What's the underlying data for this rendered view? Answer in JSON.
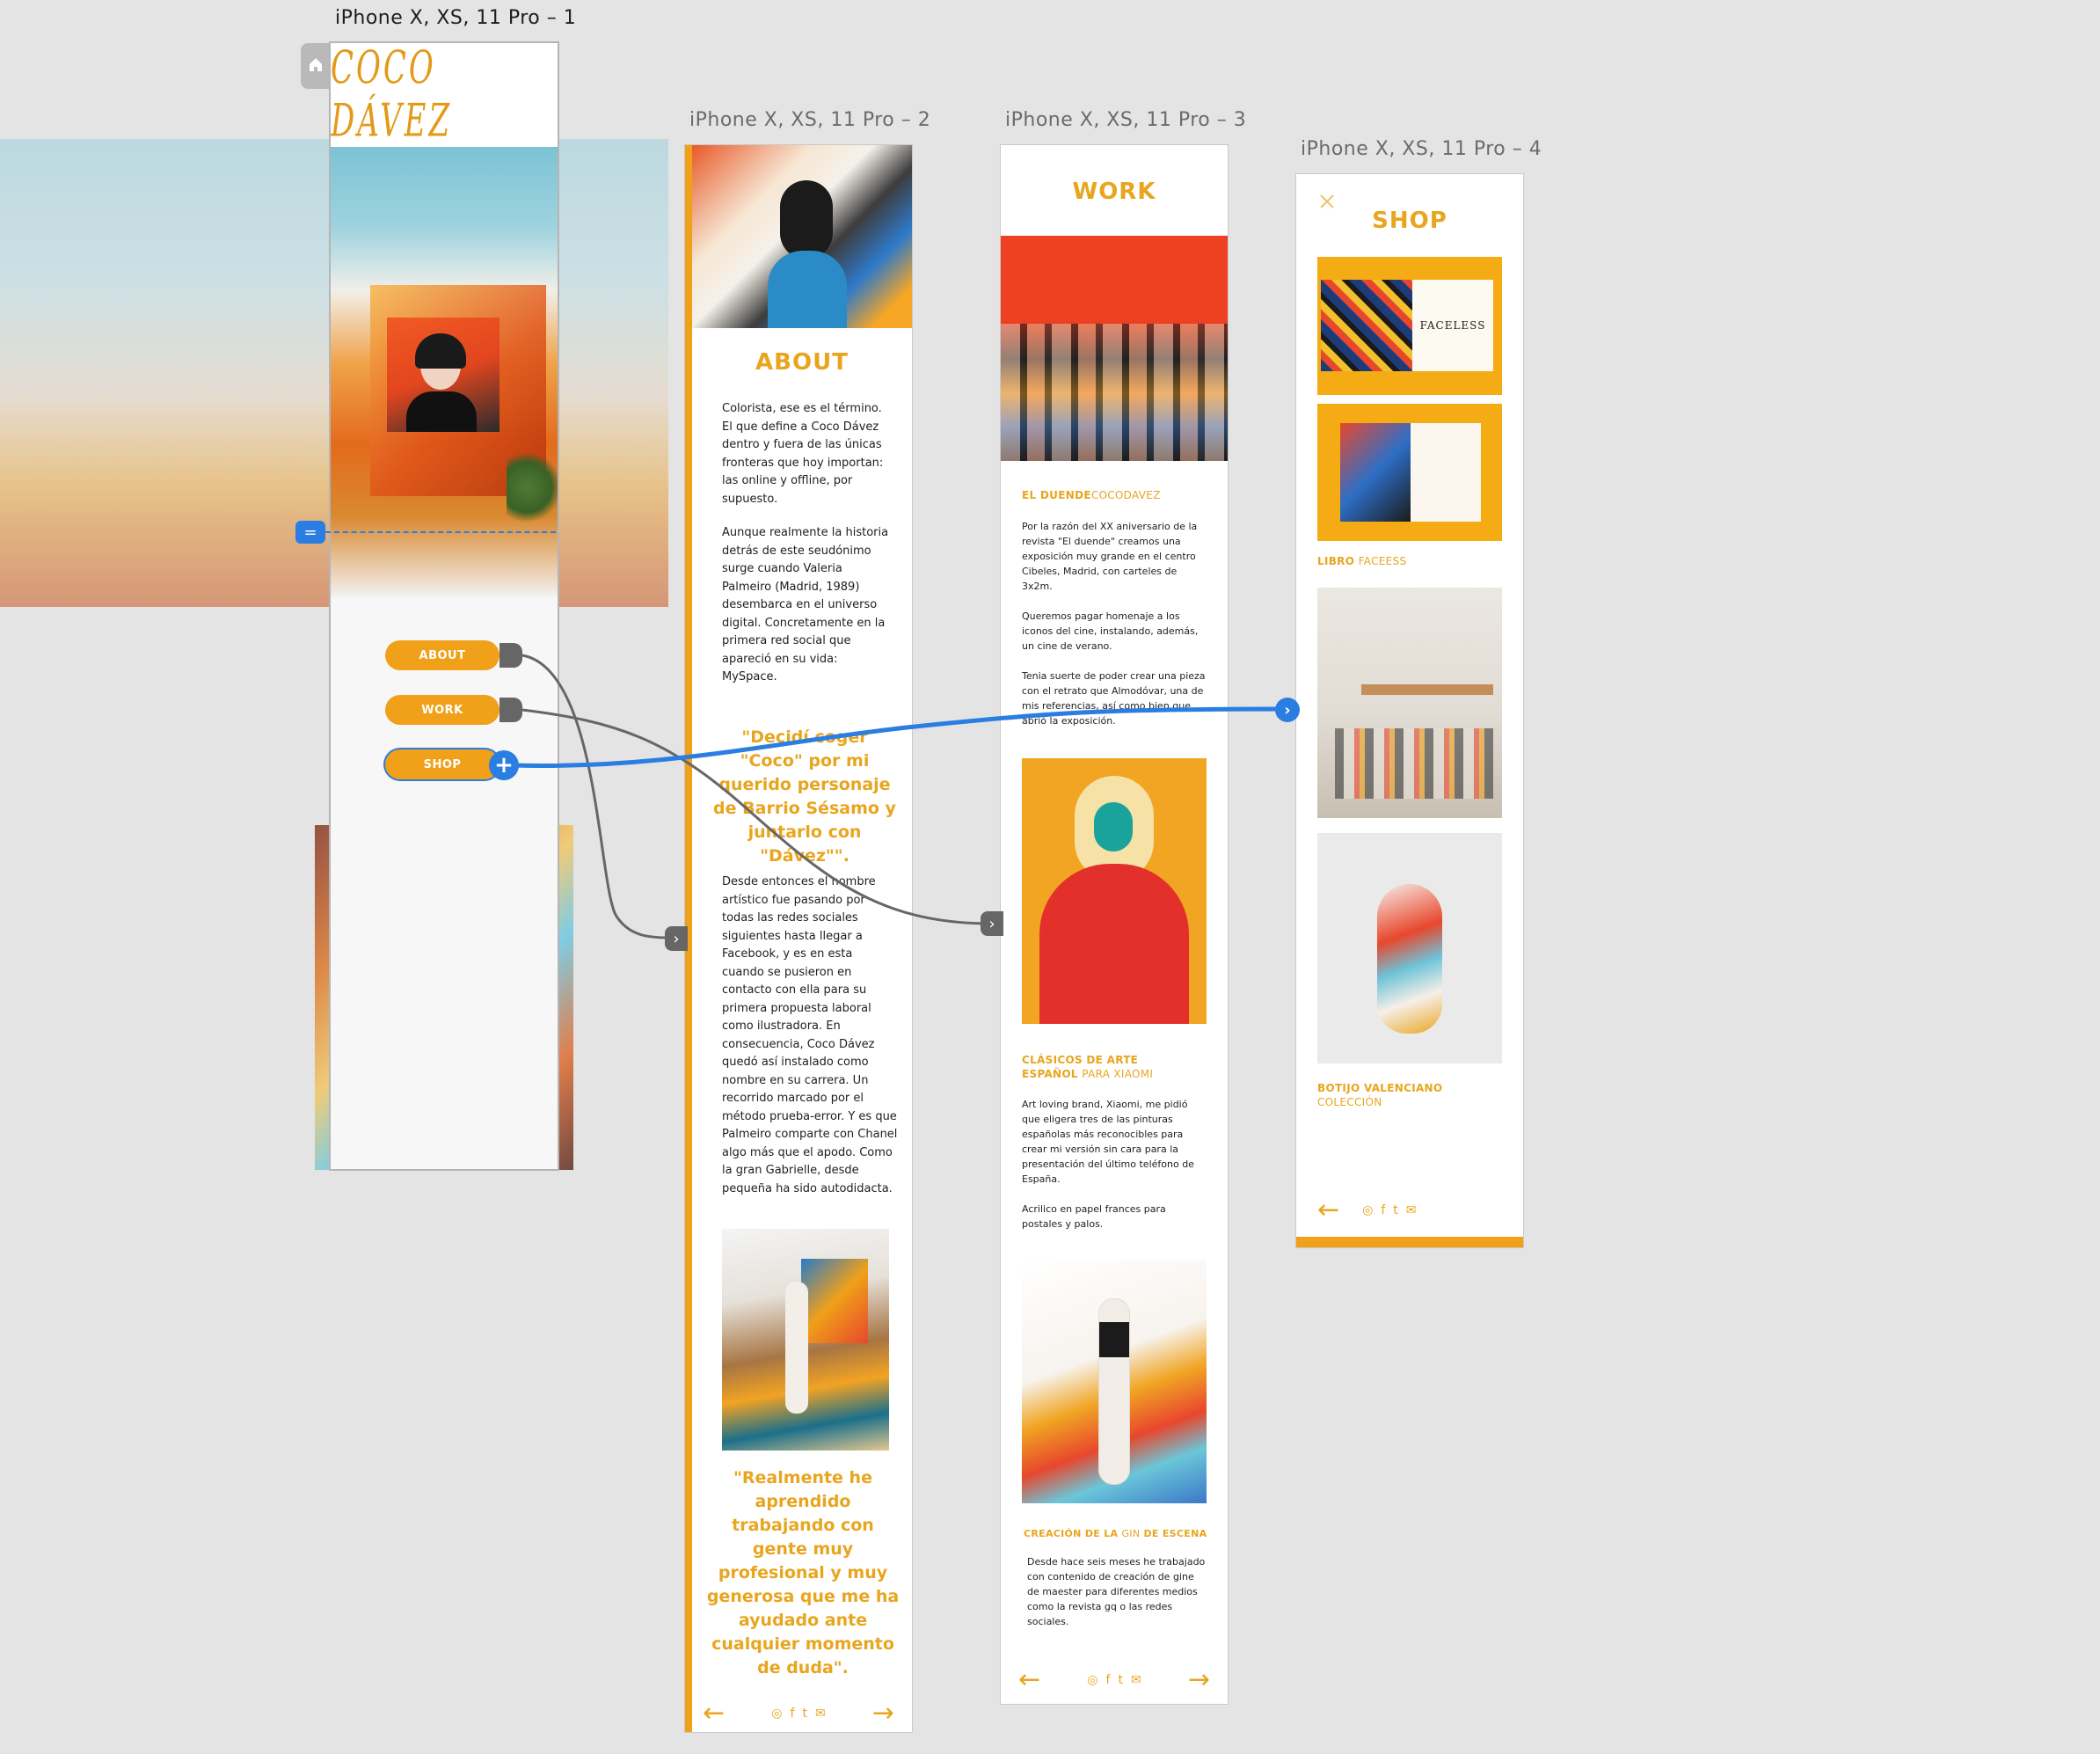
{
  "artboards": {
    "a1": {
      "title": "iPhone X, XS, 11 Pro – 1"
    },
    "a2": {
      "title": "iPhone X, XS, 11 Pro – 2"
    },
    "a3": {
      "title": "iPhone X, XS, 11 Pro – 3"
    },
    "a4": {
      "title": "iPhone X, XS, 11 Pro – 4"
    }
  },
  "home": {
    "logo": "COCO DÁVEZ",
    "menu": [
      "ABOUT",
      "WORK",
      "SHOP"
    ]
  },
  "about": {
    "title": "ABOUT",
    "p1": "Colorista, ese es el término. El que define a Coco Dávez dentro y fuera de las únicas fronteras que hoy importan: las online y offline, por supuesto.",
    "p2": "Aunque realmente la historia detrás de este seudónimo surge cuando Valeria Palmeiro (Madrid, 1989) desembarca en el universo digital. Concretamente en la primera red social que apareció en su vida: MySpace.",
    "quote1": "\"Decidí coger \"Coco\" por mi querido personaje de Barrio Sésamo y juntarlo con \"Dávez\"\".",
    "p3": "Desde entonces el nombre artístico fue pasando por todas las redes sociales siguientes hasta llegar a Facebook, y es en esta cuando se pusieron en contacto con ella para su primera propuesta laboral como ilustradora. En consecuencia, Coco Dávez quedó así instalado como nombre en su carrera. Un recorrido marcado por el método prueba-error. Y es que Palmeiro comparte con Chanel algo más que el apodo. Como la gran Gabrielle, desde pequeña ha sido autodidacta.",
    "quote2": "\"Realmente he aprendido trabajando con gente muy profesional y muy generosa que me ha ayudado ante cualquier momento de duda\"."
  },
  "work": {
    "title": "WORK",
    "cap1_bold": "EL DUENDE",
    "cap1_light": "COCODAVEZ",
    "t1a": "Por la razón del XX aniversario de la revista \"El duende\" creamos una exposición muy grande en el centro Cibeles, Madrid, con carteles de 3x2m.",
    "t1b": "Queremos pagar homenaje a los iconos del cine, instalando, además, un cine de verano.",
    "t1c": "Tenia suerte de poder crear una pieza con el retrato que Almodóvar, una de mis referencias, así como bien que abrió la exposición.",
    "cap2_bold": "CLÁSICOS DE ARTE ESPAÑOL",
    "cap2_light": "PARA XIAOMI",
    "t2a": "Art loving brand, Xiaomi, me pidió que eligera tres de las pinturas españolas más reconocibles para crear mi versión sin cara para la presentación del último teléfono de España.",
    "t2b": "Acrilico en papel frances para postales y palos.",
    "cap3_a": "CREACIÓN DE LA ",
    "cap3_light": "GIN",
    "cap3_b": " DE ESCENA",
    "t3": "Desde hace seis meses he trabajado con contenido de creación de gine de maester para diferentes medios como la revista gq o las redes sociales."
  },
  "shop": {
    "title": "SHOP",
    "cap1_bold": "LIBRO",
    "cap1_light": "FACEESS",
    "cap2_bold": "BOTIJO VALENCIANO",
    "cap2_light": "COLECCIÓN",
    "book_word": "FACELESS"
  },
  "nav": {
    "back": "←",
    "forward": "→",
    "social": [
      "◎",
      "f",
      "t",
      "✉"
    ]
  },
  "icons": {
    "home": "home-icon",
    "close": "close-icon",
    "plus": "+",
    "chevron": "›",
    "equals": "="
  },
  "colors": {
    "accent": "#e8a51e",
    "pill": "#f0a019",
    "selection_blue": "#2a7de1",
    "connector_gray": "#666666"
  }
}
